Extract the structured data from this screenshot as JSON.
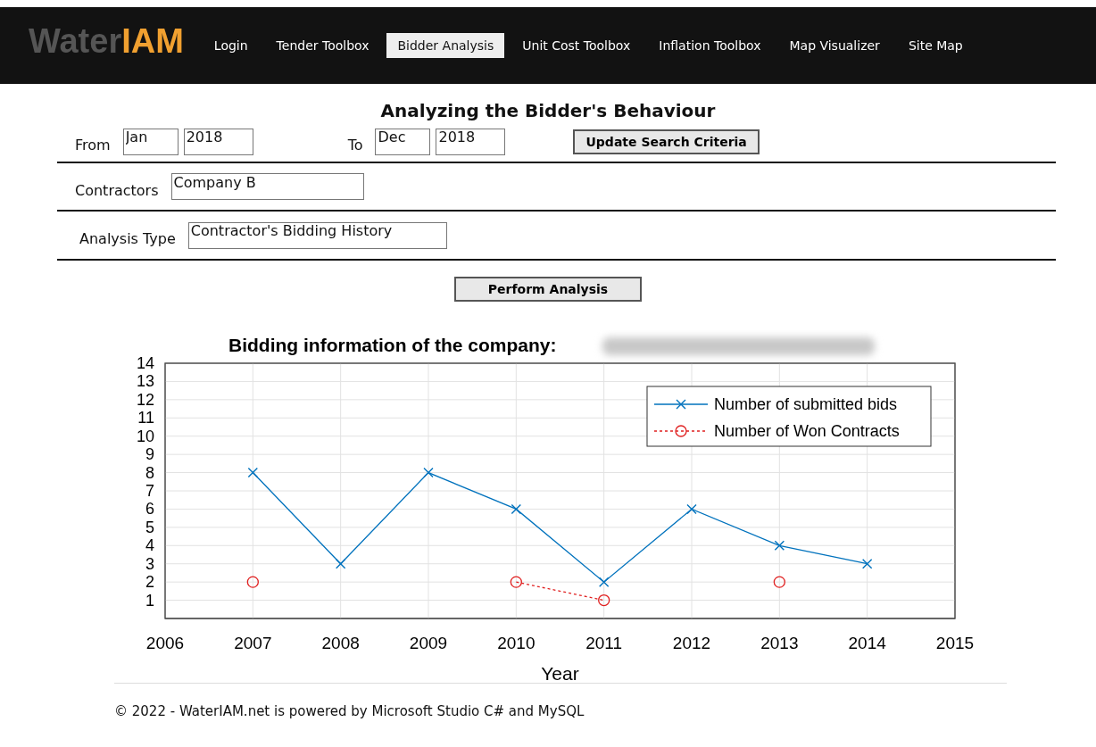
{
  "brand": {
    "part_1": "Water",
    "part_2": "IAM"
  },
  "nav": [
    {
      "label": "Login",
      "selected": false
    },
    {
      "label": "Tender Toolbox",
      "selected": false
    },
    {
      "label": "Bidder Analysis",
      "selected": true
    },
    {
      "label": "Unit Cost Toolbox",
      "selected": false
    },
    {
      "label": "Inflation Toolbox",
      "selected": false
    },
    {
      "label": "Map Visualizer",
      "selected": false
    },
    {
      "label": "Site Map",
      "selected": false
    }
  ],
  "heading": "Analyzing the Bidder's Behaviour",
  "period": {
    "from_label": "From",
    "from_month": "Jan",
    "from_year": "2018",
    "to_label": "To",
    "to_month": "Dec",
    "to_year": "2018",
    "button": "Update Search Criteria"
  },
  "contractors": {
    "label": "Contractors",
    "value": "Company B"
  },
  "analysis_type": {
    "label": "Analysis Type",
    "value": "Contractor's Bidding History"
  },
  "perform_button": "Perform Analysis",
  "chart_data": {
    "type": "line",
    "title": "Bidding information of the company:",
    "xlabel": "Year",
    "x": [
      2007,
      2008,
      2009,
      2010,
      2011,
      2012,
      2013,
      2014
    ],
    "xlim": [
      2006,
      2015
    ],
    "ylim": [
      0,
      14
    ],
    "xticks": [
      2006,
      2007,
      2008,
      2009,
      2010,
      2011,
      2012,
      2013,
      2014,
      2015
    ],
    "yticks": [
      1,
      2,
      3,
      4,
      5,
      6,
      7,
      8,
      9,
      10,
      11,
      12,
      13,
      14
    ],
    "grid": true,
    "legend": true,
    "series": [
      {
        "name": "Number of submitted bids",
        "color": "#0072bd",
        "marker": "x",
        "line_style": "solid",
        "values": [
          8,
          3,
          8,
          6,
          2,
          6,
          4,
          3
        ]
      },
      {
        "name": "Number of Won Contracts",
        "color": "#e02020",
        "marker": "o",
        "line_style": "dashed",
        "values": [
          2,
          null,
          null,
          2,
          1,
          null,
          2,
          null
        ]
      }
    ]
  },
  "footer": "© 2022 - WaterIAM.net is powered by Microsoft Studio C# and MySQL"
}
